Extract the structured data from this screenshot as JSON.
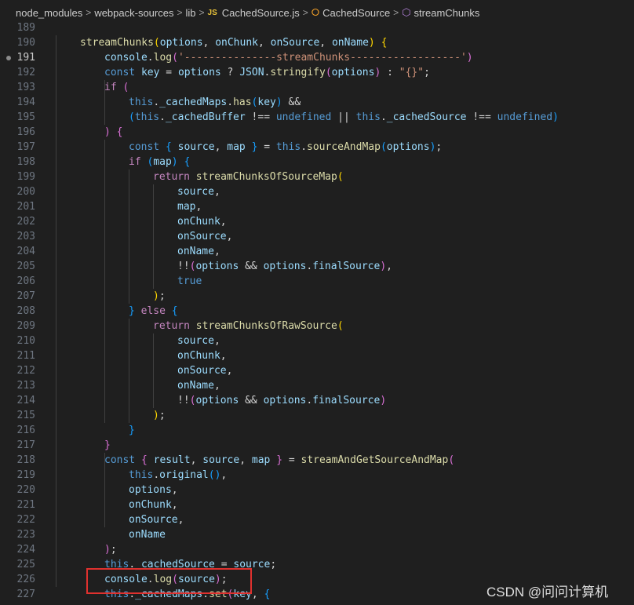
{
  "breadcrumb": {
    "segments": [
      "node_modules",
      "webpack-sources",
      "lib",
      "CachedSource.js",
      "CachedSource",
      "streamChunks"
    ],
    "separator": ">",
    "js_badge": "JS"
  },
  "editor": {
    "current_line": 191,
    "lines": [
      {
        "n": "189",
        "t": []
      },
      {
        "n": "190",
        "t": [
          [
            "f",
            "streamChunks"
          ],
          [
            "b1",
            "("
          ],
          [
            "v",
            "options"
          ],
          [
            "p",
            ", "
          ],
          [
            "v",
            "onChunk"
          ],
          [
            "p",
            ", "
          ],
          [
            "v",
            "onSource"
          ],
          [
            "p",
            ", "
          ],
          [
            "v",
            "onName"
          ],
          [
            "b1",
            ")"
          ],
          [
            "p",
            " "
          ],
          [
            "b1",
            "{"
          ]
        ]
      },
      {
        "n": "191",
        "t": [
          [
            "v",
            "console"
          ],
          [
            "p",
            "."
          ],
          [
            "f",
            "log"
          ],
          [
            "b2",
            "("
          ],
          [
            "s",
            "'---------------streamChunks------------------'"
          ],
          [
            "b2",
            ")"
          ]
        ]
      },
      {
        "n": "192",
        "t": [
          [
            "k",
            "const "
          ],
          [
            "v",
            "key"
          ],
          [
            "p",
            " = "
          ],
          [
            "v",
            "options"
          ],
          [
            "p",
            " ? "
          ],
          [
            "v",
            "JSON"
          ],
          [
            "p",
            "."
          ],
          [
            "f",
            "stringify"
          ],
          [
            "b2",
            "("
          ],
          [
            "v",
            "options"
          ],
          [
            "b2",
            ")"
          ],
          [
            "p",
            " : "
          ],
          [
            "s",
            "\"{}\""
          ],
          [
            "p",
            ";"
          ]
        ]
      },
      {
        "n": "193",
        "t": [
          [
            "c",
            "if "
          ],
          [
            "b2",
            "("
          ]
        ]
      },
      {
        "n": "194",
        "t": [
          [
            "k",
            "this"
          ],
          [
            "p",
            "."
          ],
          [
            "v",
            "_cachedMaps"
          ],
          [
            "p",
            "."
          ],
          [
            "f",
            "has"
          ],
          [
            "b3",
            "("
          ],
          [
            "v",
            "key"
          ],
          [
            "b3",
            ")"
          ],
          [
            "p",
            " &&"
          ]
        ]
      },
      {
        "n": "195",
        "t": [
          [
            "b3",
            "("
          ],
          [
            "k",
            "this"
          ],
          [
            "p",
            "."
          ],
          [
            "v",
            "_cachedBuffer"
          ],
          [
            "p",
            " !== "
          ],
          [
            "k",
            "undefined"
          ],
          [
            "p",
            " || "
          ],
          [
            "k",
            "this"
          ],
          [
            "p",
            "."
          ],
          [
            "v",
            "_cachedSource"
          ],
          [
            "p",
            " !== "
          ],
          [
            "k",
            "undefined"
          ],
          [
            "b3",
            ")"
          ]
        ]
      },
      {
        "n": "196",
        "t": [
          [
            "b2",
            ")"
          ],
          [
            "p",
            " "
          ],
          [
            "b2",
            "{"
          ]
        ]
      },
      {
        "n": "197",
        "t": [
          [
            "k",
            "const "
          ],
          [
            "b3",
            "{"
          ],
          [
            "v",
            " source"
          ],
          [
            "p",
            ", "
          ],
          [
            "v",
            "map "
          ],
          [
            "b3",
            "}"
          ],
          [
            "p",
            " = "
          ],
          [
            "k",
            "this"
          ],
          [
            "p",
            "."
          ],
          [
            "f",
            "sourceAndMap"
          ],
          [
            "b3",
            "("
          ],
          [
            "v",
            "options"
          ],
          [
            "b3",
            ")"
          ],
          [
            "p",
            ";"
          ]
        ]
      },
      {
        "n": "198",
        "t": [
          [
            "c",
            "if "
          ],
          [
            "b3",
            "("
          ],
          [
            "v",
            "map"
          ],
          [
            "b3",
            ")"
          ],
          [
            "p",
            " "
          ],
          [
            "b3",
            "{"
          ]
        ]
      },
      {
        "n": "199",
        "t": [
          [
            "c",
            "return "
          ],
          [
            "f",
            "streamChunksOfSourceMap"
          ],
          [
            "b1",
            "("
          ]
        ]
      },
      {
        "n": "200",
        "t": [
          [
            "v",
            "source"
          ],
          [
            "p",
            ","
          ]
        ]
      },
      {
        "n": "201",
        "t": [
          [
            "v",
            "map"
          ],
          [
            "p",
            ","
          ]
        ]
      },
      {
        "n": "202",
        "t": [
          [
            "v",
            "onChunk"
          ],
          [
            "p",
            ","
          ]
        ]
      },
      {
        "n": "203",
        "t": [
          [
            "v",
            "onSource"
          ],
          [
            "p",
            ","
          ]
        ]
      },
      {
        "n": "204",
        "t": [
          [
            "v",
            "onName"
          ],
          [
            "p",
            ","
          ]
        ]
      },
      {
        "n": "205",
        "t": [
          [
            "p",
            "!!"
          ],
          [
            "b2",
            "("
          ],
          [
            "v",
            "options"
          ],
          [
            "p",
            " && "
          ],
          [
            "v",
            "options"
          ],
          [
            "p",
            "."
          ],
          [
            "v",
            "finalSource"
          ],
          [
            "b2",
            ")"
          ],
          [
            "p",
            ","
          ]
        ]
      },
      {
        "n": "206",
        "t": [
          [
            "k",
            "true"
          ]
        ]
      },
      {
        "n": "207",
        "t": [
          [
            "b1",
            ")"
          ],
          [
            "p",
            ";"
          ]
        ]
      },
      {
        "n": "208",
        "t": [
          [
            "b3",
            "}"
          ],
          [
            "p",
            " "
          ],
          [
            "c",
            "else "
          ],
          [
            "b3",
            "{"
          ]
        ]
      },
      {
        "n": "209",
        "t": [
          [
            "c",
            "return "
          ],
          [
            "f",
            "streamChunksOfRawSource"
          ],
          [
            "b1",
            "("
          ]
        ]
      },
      {
        "n": "210",
        "t": [
          [
            "v",
            "source"
          ],
          [
            "p",
            ","
          ]
        ]
      },
      {
        "n": "211",
        "t": [
          [
            "v",
            "onChunk"
          ],
          [
            "p",
            ","
          ]
        ]
      },
      {
        "n": "212",
        "t": [
          [
            "v",
            "onSource"
          ],
          [
            "p",
            ","
          ]
        ]
      },
      {
        "n": "213",
        "t": [
          [
            "v",
            "onName"
          ],
          [
            "p",
            ","
          ]
        ]
      },
      {
        "n": "214",
        "t": [
          [
            "p",
            "!!"
          ],
          [
            "b2",
            "("
          ],
          [
            "v",
            "options"
          ],
          [
            "p",
            " && "
          ],
          [
            "v",
            "options"
          ],
          [
            "p",
            "."
          ],
          [
            "v",
            "finalSource"
          ],
          [
            "b2",
            ")"
          ]
        ]
      },
      {
        "n": "215",
        "t": [
          [
            "b1",
            ")"
          ],
          [
            "p",
            ";"
          ]
        ]
      },
      {
        "n": "216",
        "t": [
          [
            "b3",
            "}"
          ]
        ]
      },
      {
        "n": "217",
        "t": [
          [
            "b2",
            "}"
          ]
        ]
      },
      {
        "n": "218",
        "t": [
          [
            "k",
            "const "
          ],
          [
            "b2",
            "{"
          ],
          [
            "v",
            " result"
          ],
          [
            "p",
            ", "
          ],
          [
            "v",
            "source"
          ],
          [
            "p",
            ", "
          ],
          [
            "v",
            "map "
          ],
          [
            "b2",
            "}"
          ],
          [
            "p",
            " = "
          ],
          [
            "f",
            "streamAndGetSourceAndMap"
          ],
          [
            "b2",
            "("
          ]
        ]
      },
      {
        "n": "219",
        "t": [
          [
            "k",
            "this"
          ],
          [
            "p",
            "."
          ],
          [
            "v",
            "original"
          ],
          [
            "b3",
            "("
          ],
          [
            "b3",
            ")"
          ],
          [
            "p",
            ","
          ]
        ]
      },
      {
        "n": "220",
        "t": [
          [
            "v",
            "options"
          ],
          [
            "p",
            ","
          ]
        ]
      },
      {
        "n": "221",
        "t": [
          [
            "v",
            "onChunk"
          ],
          [
            "p",
            ","
          ]
        ]
      },
      {
        "n": "222",
        "t": [
          [
            "v",
            "onSource"
          ],
          [
            "p",
            ","
          ]
        ]
      },
      {
        "n": "223",
        "t": [
          [
            "v",
            "onName"
          ]
        ]
      },
      {
        "n": "224",
        "t": [
          [
            "b2",
            ")"
          ],
          [
            "p",
            ";"
          ]
        ]
      },
      {
        "n": "225",
        "t": [
          [
            "k",
            "this"
          ],
          [
            "p",
            "."
          ],
          [
            "v",
            "_cachedSource"
          ],
          [
            "p",
            " = "
          ],
          [
            "v",
            "source"
          ],
          [
            "p",
            ";"
          ]
        ]
      },
      {
        "n": "226",
        "t": [
          [
            "v",
            "console"
          ],
          [
            "p",
            "."
          ],
          [
            "f",
            "log"
          ],
          [
            "b2",
            "("
          ],
          [
            "v",
            "source"
          ],
          [
            "b2",
            ")"
          ],
          [
            "p",
            ";"
          ]
        ]
      },
      {
        "n": "227",
        "t": [
          [
            "k",
            "this"
          ],
          [
            "p",
            "."
          ],
          [
            "v",
            "_cachedMaps"
          ],
          [
            "p",
            "."
          ],
          [
            "f",
            "set"
          ],
          [
            "b2",
            "("
          ],
          [
            "v",
            "key"
          ],
          [
            "p",
            ", "
          ],
          [
            "b3",
            "{"
          ]
        ]
      }
    ]
  },
  "watermark": "CSDN @问问计算机"
}
